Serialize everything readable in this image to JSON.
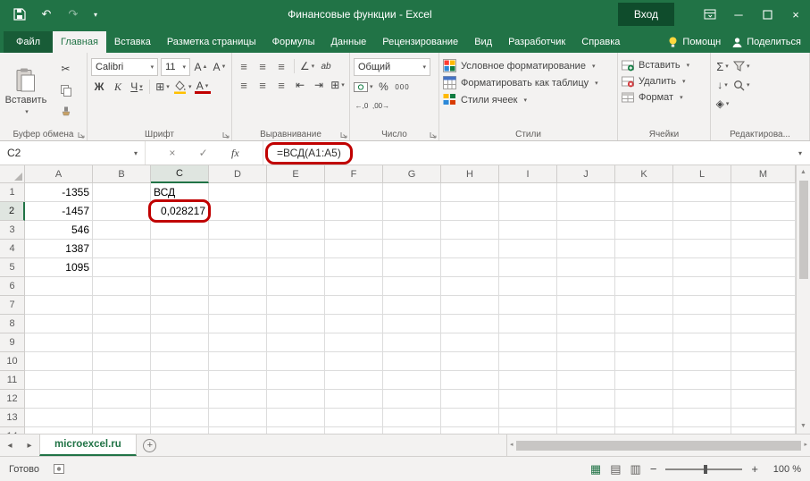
{
  "colors": {
    "excel_green": "#217346",
    "annotation_red": "#c00000",
    "ribbon_bg": "#f3f2f1"
  },
  "title_bar": {
    "title": "Финансовые функции  -  Excel",
    "sign_in": "Вход"
  },
  "tabs": {
    "file": "Файл",
    "items": [
      "Главная",
      "Вставка",
      "Разметка страницы",
      "Формулы",
      "Данные",
      "Рецензирование",
      "Вид",
      "Разработчик",
      "Справка"
    ],
    "active": "Главная",
    "assistant": "Помощн",
    "share": "Поделиться"
  },
  "ribbon": {
    "clipboard": {
      "label": "Буфер обмена",
      "paste": "Вставить"
    },
    "font": {
      "label": "Шрифт",
      "name": "Calibri",
      "size": "11",
      "bold": "Ж",
      "italic": "К",
      "underline": "Ч"
    },
    "alignment": {
      "label": "Выравнивание"
    },
    "number": {
      "label": "Число",
      "format": "Общий"
    },
    "styles": {
      "label": "Стили",
      "conditional": "Условное форматирование",
      "format_table": "Форматировать как таблицу",
      "cell_styles": "Стили ячеек"
    },
    "cells": {
      "label": "Ячейки",
      "insert": "Вставить",
      "delete": "Удалить",
      "format": "Формат"
    },
    "editing": {
      "label": "Редактирова..."
    }
  },
  "formula_bar": {
    "name_box": "C2",
    "formula": "=ВСД(A1:A5)"
  },
  "grid": {
    "columns": [
      "A",
      "B",
      "C",
      "D",
      "E",
      "F",
      "G",
      "H",
      "I",
      "J",
      "K",
      "L",
      "M"
    ],
    "row_count": 14,
    "selection": {
      "col": "C",
      "row": 2,
      "active_cell": "C2"
    },
    "cells": [
      {
        "col": "A",
        "row": 1,
        "value": "-1355",
        "align": "right"
      },
      {
        "col": "A",
        "row": 2,
        "value": "-1457",
        "align": "right"
      },
      {
        "col": "A",
        "row": 3,
        "value": "546",
        "align": "right"
      },
      {
        "col": "A",
        "row": 4,
        "value": "1387",
        "align": "right"
      },
      {
        "col": "A",
        "row": 5,
        "value": "1095",
        "align": "right"
      },
      {
        "col": "C",
        "row": 1,
        "value": "ВСД",
        "align": "left"
      },
      {
        "col": "C",
        "row": 2,
        "value": "0,028217",
        "align": "right",
        "annotated": true
      }
    ]
  },
  "sheet_bar": {
    "active_tab": "microexcel.ru"
  },
  "status_bar": {
    "ready": "Готово",
    "zoom": "100 %"
  },
  "icons": {
    "caret": "▾",
    "undo": "↶",
    "redo": "↷",
    "minimize": "─",
    "close": "×",
    "cut": "✂",
    "borders": "⊞",
    "merge": "⊞",
    "align_lines": "≡",
    "wrap_text": "ab",
    "indent_decrease": "⇤",
    "indent_increase": "⇥",
    "orientation": "∠",
    "percent": "%",
    "thousands": "000",
    "increase_decimal": "←,0",
    "decrease_decimal": ",00→",
    "autosum": "Σ",
    "fill_down": "↓",
    "clear": "◈",
    "grow_font": "А",
    "shrink_font": "А",
    "font_color_letter": "А",
    "cancel": "×",
    "enter": "✓",
    "fx": "fx",
    "nav_left": "◂",
    "nav_right": "▸",
    "scroll_up": "▲",
    "scroll_down": "▼",
    "zoom_out": "−",
    "zoom_in": "+",
    "add_sheet": "+",
    "normal_view": "▦",
    "page_layout_view": "▤",
    "page_break_view": "▥"
  }
}
